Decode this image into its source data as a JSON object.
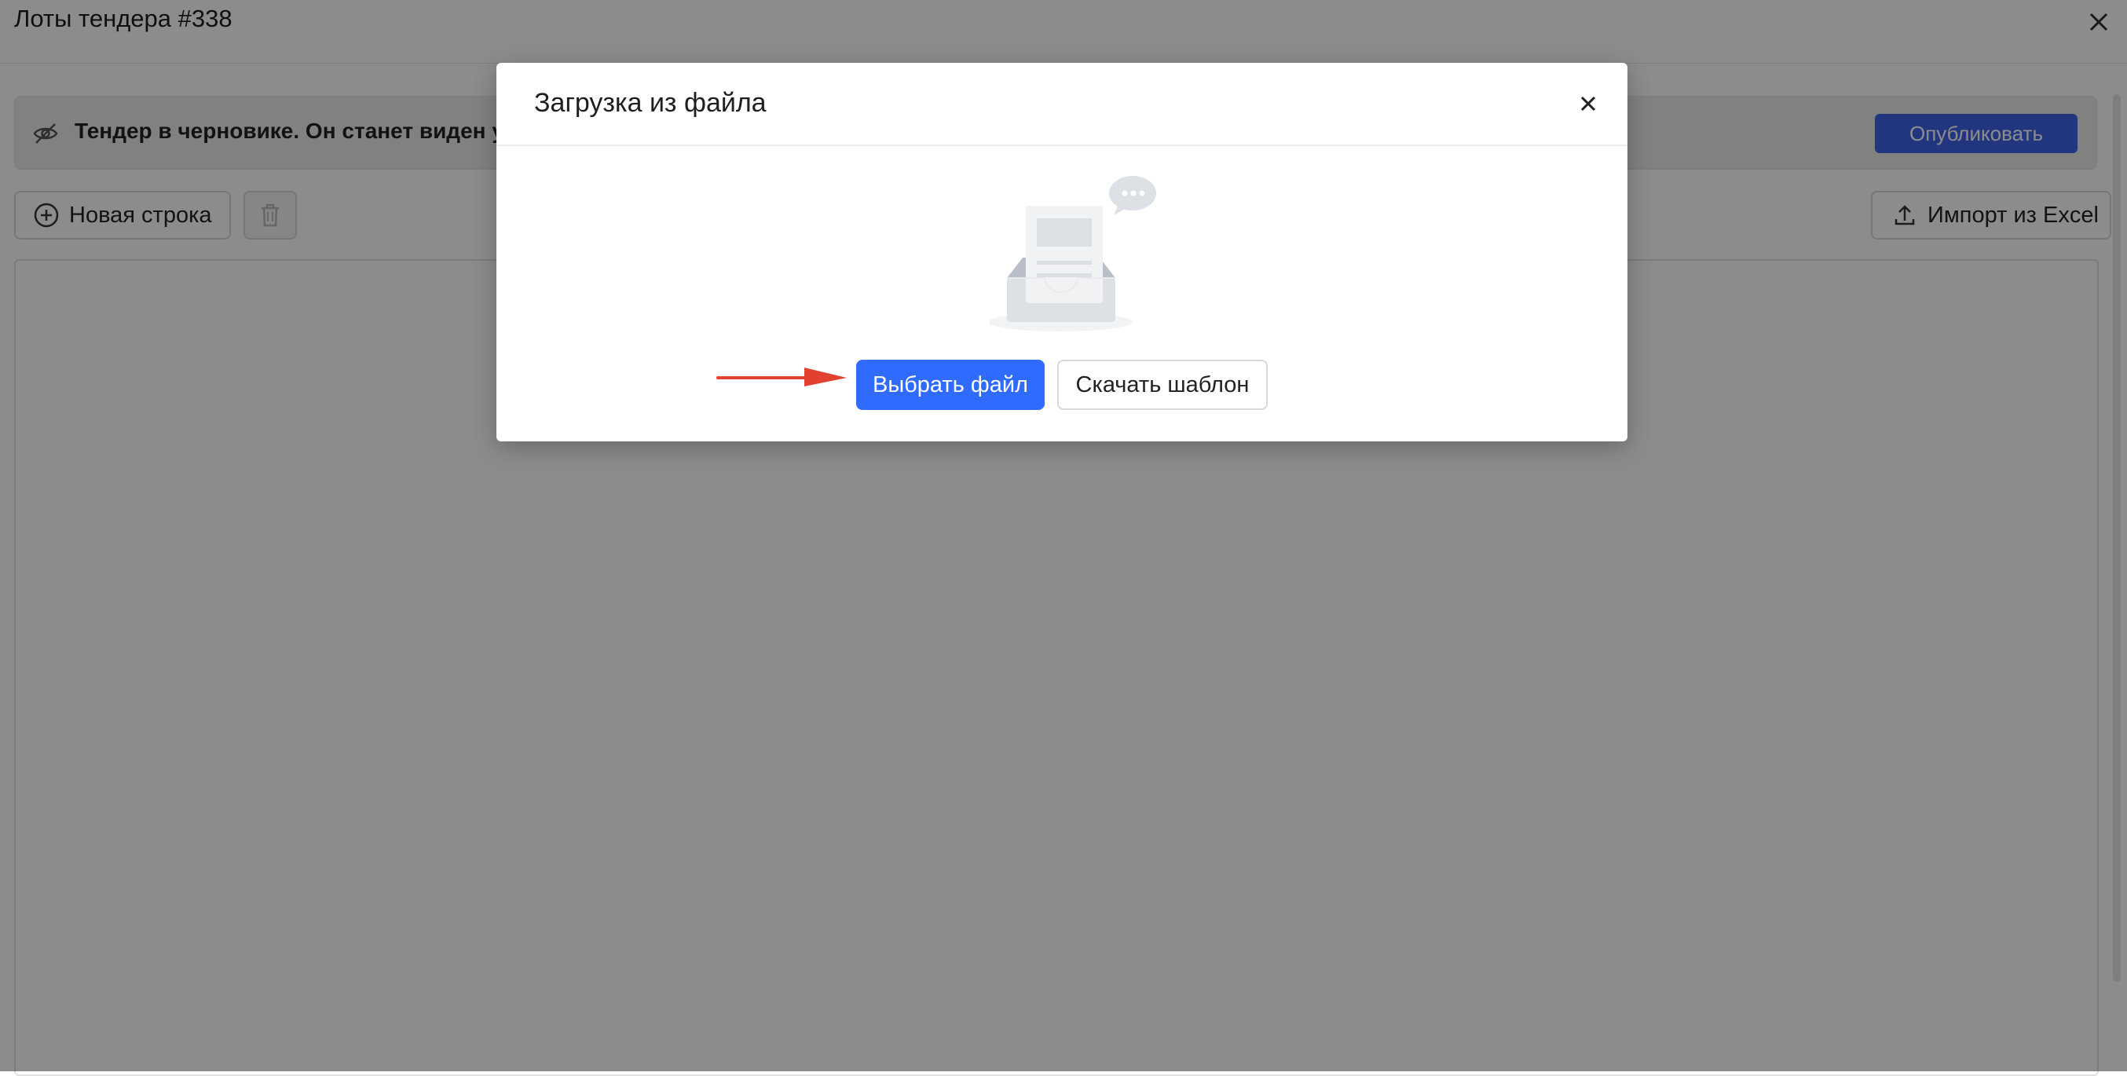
{
  "page": {
    "title": "Лоты тендера #338"
  },
  "banner": {
    "text": "Тендер в черновике. Он станет виден уча",
    "publish_label": "Опубликовать"
  },
  "toolbar": {
    "new_row_label": "Новая строка",
    "import_label": "Импорт из Excel"
  },
  "modal": {
    "title": "Загрузка из файла",
    "choose_file_label": "Выбрать файл",
    "download_template_label": "Скачать шаблон"
  },
  "colors": {
    "accent": "#2f6bff",
    "publish": "#3c63e6",
    "annotation_arrow": "#e2412f"
  },
  "icons": [
    "close-icon",
    "hidden-eye-icon",
    "plus-circle-icon",
    "trash-icon",
    "upload-icon",
    "empty-inbox-illustration",
    "arrow-annotation"
  ]
}
